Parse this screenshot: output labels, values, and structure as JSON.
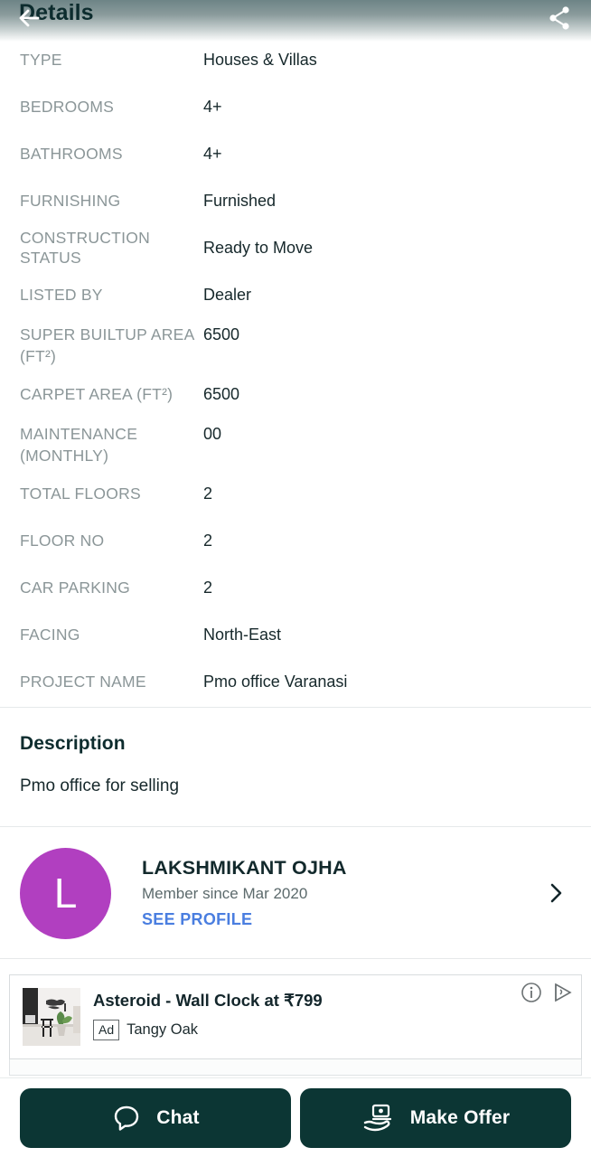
{
  "header": {
    "title": "Details",
    "back_icon": "arrow-left-icon",
    "share_icon": "share-icon",
    "gradient_from": "#6d8486",
    "gradient_to": "#ffffff"
  },
  "details": {
    "rows": [
      {
        "label": "TYPE",
        "value": "Houses & Villas"
      },
      {
        "label": "BEDROOMS",
        "value": "4+"
      },
      {
        "label": "BATHROOMS",
        "value": "4+"
      },
      {
        "label": "FURNISHING",
        "value": "Furnished"
      },
      {
        "label": "CONSTRUCTION STATUS",
        "value": "Ready to Move"
      },
      {
        "label": "LISTED BY",
        "value": "Dealer"
      },
      {
        "label": "SUPER BUILTUP AREA (FT²)",
        "value": "6500"
      },
      {
        "label": "CARPET AREA (FT²)",
        "value": "6500"
      },
      {
        "label": "MAINTENANCE (MONTHLY)",
        "value": "00"
      },
      {
        "label": "TOTAL FLOORS",
        "value": "2"
      },
      {
        "label": "FLOOR NO",
        "value": "2"
      },
      {
        "label": "CAR PARKING",
        "value": "2"
      },
      {
        "label": "FACING",
        "value": "North-East"
      },
      {
        "label": "PROJECT NAME",
        "value": "Pmo office Varanasi"
      }
    ]
  },
  "description": {
    "title": "Description",
    "body": "Pmo office for selling"
  },
  "seller": {
    "avatar_initial": "L",
    "avatar_color": "#b13fc0",
    "name": "LAKSHMIKANT OJHA",
    "member_since": "Member since Mar 2020",
    "see_profile_label": "SEE PROFILE",
    "see_profile_color": "#4a7ee0",
    "chevron_icon": "chevron-right-icon"
  },
  "ad": {
    "title": "Asteroid - Wall Clock  at ₹799",
    "badge": "Ad",
    "brand": "Tangy Oak",
    "info_icon": "info-circle-icon",
    "adchoices_icon": "adchoices-triangle-icon",
    "thumbnail": "wall-clock-room-photo"
  },
  "bottom_bar": {
    "chat_label": "Chat",
    "chat_icon": "chat-bubble-icon",
    "offer_label": "Make Offer",
    "offer_icon": "hand-money-icon",
    "button_color": "#0c3634"
  }
}
